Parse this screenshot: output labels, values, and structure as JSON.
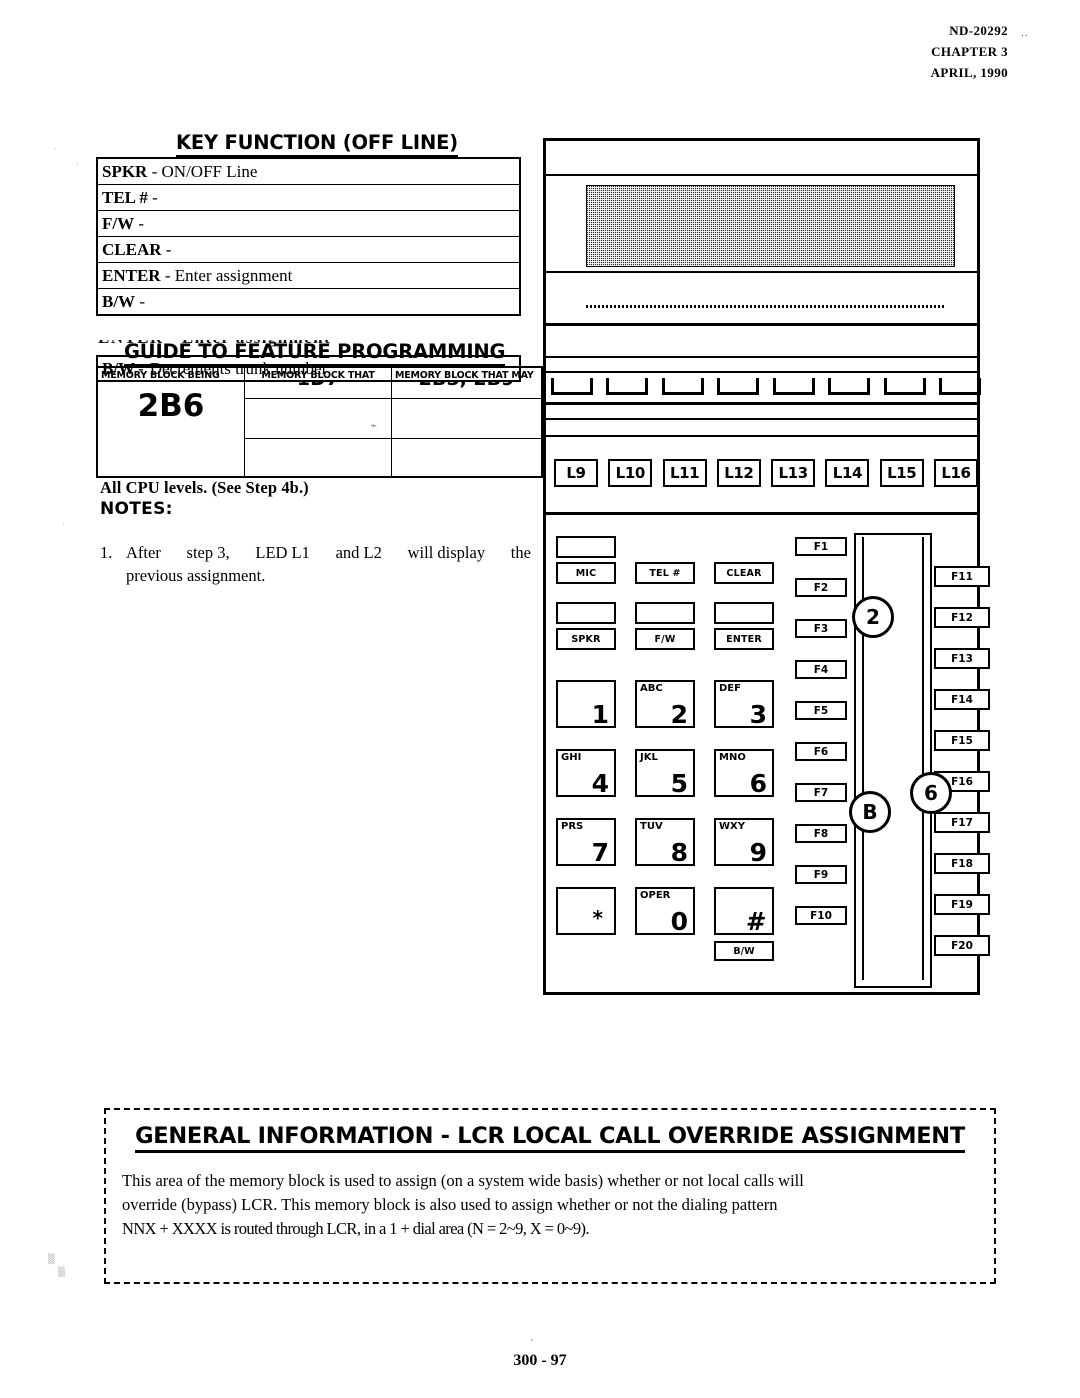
{
  "header": {
    "doc_number": "ND-20292",
    "chapter": "CHAPTER 3",
    "date": "APRIL, 1990",
    "tick_mark": "··"
  },
  "key_function": {
    "title": "KEY FUNCTION (OFF LINE)",
    "rows": [
      {
        "key": "SPKR",
        "dash": "-",
        "desc": "ON/OFF Line"
      },
      {
        "key": "TEL #",
        "dash": "-",
        "desc": ""
      },
      {
        "key": "F/W",
        "dash": "-",
        "desc": ""
      },
      {
        "key": "CLEAR",
        "dash": "-",
        "desc": ""
      },
      {
        "key": "ENTER",
        "dash": "-",
        "desc": "Enter assignment"
      },
      {
        "key": "B/W",
        "dash": "-",
        "desc": ""
      }
    ],
    "ghost_text": "ENTER -   Enter assignment",
    "bottom_row": {
      "key": "B/W",
      "dash": "-",
      "desc": "Decrements trunk number"
    }
  },
  "guide": {
    "title": "GUIDE TO FEATURE PROGRAMMING",
    "col1_header": "MEMORY BLOCK BEING",
    "col2_header": "MEMORY BLOCK THAT",
    "col3_header": "MEMORY BLOCK THAT MAY",
    "col1_value": "2B6",
    "col2_ghost": "1D7",
    "col3_ghost": "2B5, 2B9",
    "squiggle": "⌁"
  },
  "notes": {
    "cpu_line": "All CPU levels.  (See Step 4b.)",
    "label": "NOTES:",
    "items": [
      {
        "number": "1.",
        "line1": [
          "After",
          "step 3,",
          "LED L1",
          "and L2",
          "will display",
          "the"
        ],
        "line2": "previous assignment."
      }
    ]
  },
  "phone": {
    "line_buttons_top": [
      "",
      "",
      "",
      "",
      "",
      "",
      "",
      ""
    ],
    "line_buttons": [
      "L9",
      "L10",
      "L11",
      "L12",
      "L13",
      "L14",
      "L15",
      "L16"
    ],
    "function_keys_row1": [
      "MIC",
      "TEL #",
      "CLEAR"
    ],
    "function_keys_row2": [
      "SPKR",
      "F/W",
      "ENTER"
    ],
    "keypad": [
      {
        "alpha": "",
        "digit": "1"
      },
      {
        "alpha": "ABC",
        "digit": "2"
      },
      {
        "alpha": "DEF",
        "digit": "3"
      },
      {
        "alpha": "GHI",
        "digit": "4"
      },
      {
        "alpha": "JKL",
        "digit": "5"
      },
      {
        "alpha": "MNO",
        "digit": "6"
      },
      {
        "alpha": "PRS",
        "digit": "7"
      },
      {
        "alpha": "TUV",
        "digit": "8"
      },
      {
        "alpha": "WXY",
        "digit": "9"
      },
      {
        "alpha": "",
        "digit": "*"
      },
      {
        "alpha": "OPER",
        "digit": "0"
      },
      {
        "alpha": "",
        "digit": "#"
      }
    ],
    "bw_key": "B/W",
    "f_keys_left": [
      "F1",
      "F2",
      "F3",
      "F4",
      "F5",
      "F6",
      "F7",
      "F8",
      "F9",
      "F10"
    ],
    "f_keys_right": [
      "F11",
      "F12",
      "F13",
      "F14",
      "F15",
      "F16",
      "F17",
      "F18",
      "F19",
      "F20"
    ],
    "callouts": [
      {
        "id": "callout-2",
        "label": "2"
      },
      {
        "id": "callout-b",
        "label": "B"
      },
      {
        "id": "callout-6",
        "label": "6"
      }
    ]
  },
  "general_info": {
    "title": "GENERAL INFORMATION - LCR LOCAL CALL OVERRIDE ASSIGNMENT",
    "paragraph_line1": "This area of the memory block is used to assign (on a system wide basis) whether or not local calls will",
    "paragraph_line2": "override (bypass) LCR.  This memory block is also used to assign whether or not the dialing pattern",
    "paragraph_line3": "NNX + XXXX is routed through LCR, in a 1 + dial area (N = 2~9, X = 0~9)."
  },
  "footer": {
    "page": "300 - 97"
  }
}
